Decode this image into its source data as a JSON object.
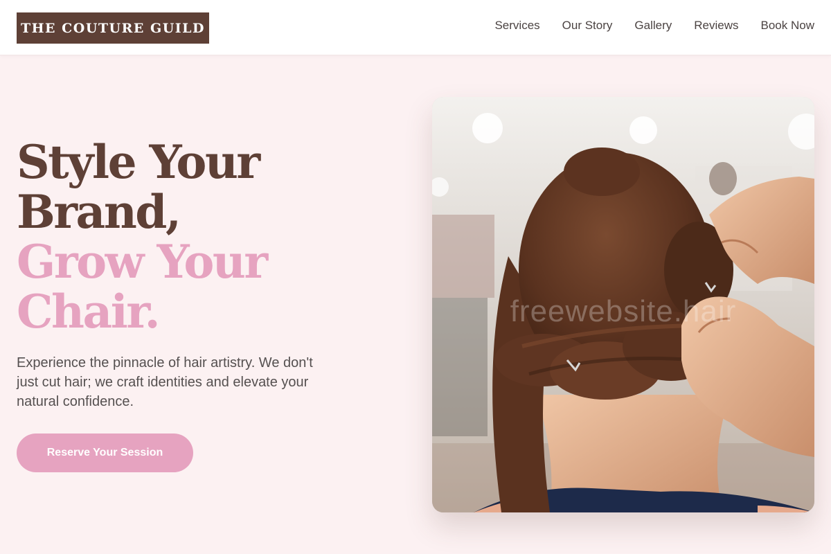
{
  "brand": {
    "name": "THE COUTURE GUILD"
  },
  "nav": {
    "items": [
      {
        "label": "Services"
      },
      {
        "label": "Our Story"
      },
      {
        "label": "Gallery"
      },
      {
        "label": "Reviews"
      },
      {
        "label": "Book Now"
      }
    ]
  },
  "hero": {
    "headline_line1": "Style Your",
    "headline_line2": "Brand,",
    "headline_line3": "Grow Your",
    "headline_line4": "Chair.",
    "description": "Experience the pinnacle of hair artistry. We don't just cut hair; we craft identities and elevate your natural confidence.",
    "cta_label": "Reserve Your Session",
    "image_watermark": "freewebsite.hair",
    "image_subject": "hairstylist-pinning-updo-photo"
  },
  "colors": {
    "brand_dark": "#5e4036",
    "accent_pink": "#e6a3c0",
    "page_background": "#fcf1f2",
    "header_background": "#ffffff"
  }
}
